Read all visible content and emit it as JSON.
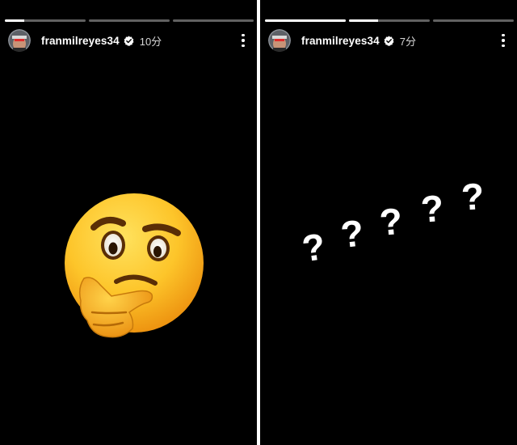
{
  "stories": [
    {
      "username": "franmilreyes34",
      "time": "10分",
      "verified": true,
      "progress": [
        0.24,
        0,
        0
      ],
      "sticker": "thinking-face-emoji"
    },
    {
      "username": "franmilreyes34",
      "time": "7分",
      "verified": true,
      "progress": [
        1,
        0.36,
        0
      ],
      "text_sticker": "? ? ? ? ?"
    }
  ],
  "colors": {
    "background": "#000000",
    "text": "#ffffff",
    "progress_track": "#6b6b6b",
    "verified_badge": "#ffffff",
    "divider": "#ffffff"
  },
  "icons": [
    "avatar",
    "verified-badge-icon",
    "more-options-icon",
    "thinking-face-emoji",
    "question-mark"
  ]
}
